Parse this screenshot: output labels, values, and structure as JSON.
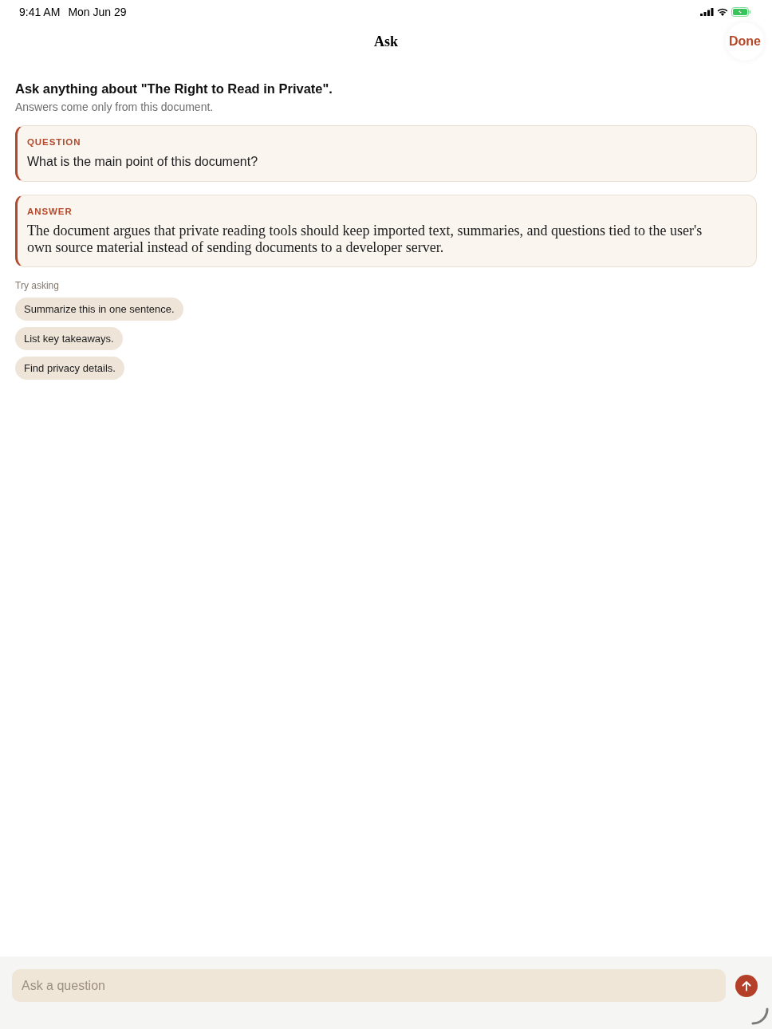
{
  "status_bar": {
    "time": "9:41 AM",
    "date": "Mon Jun 29"
  },
  "nav": {
    "title": "Ask",
    "done": "Done"
  },
  "intro": {
    "heading": "Ask anything about \"The Right to Read in Private\".",
    "subtitle": "Answers come only from this document."
  },
  "messages": [
    {
      "kind": "question",
      "label": "QUESTION",
      "text": "What is the main point of this document?"
    },
    {
      "kind": "answer",
      "label": "ANSWER",
      "text": "The document argues that private reading tools should keep imported text, summaries, and questions tied to the user's own source material instead of sending documents to a developer server."
    }
  ],
  "suggestions": {
    "label": "Try asking",
    "items": [
      "Summarize this in one sentence.",
      "List key takeaways.",
      "Find privacy details."
    ]
  },
  "composer": {
    "placeholder": "Ask a question"
  }
}
